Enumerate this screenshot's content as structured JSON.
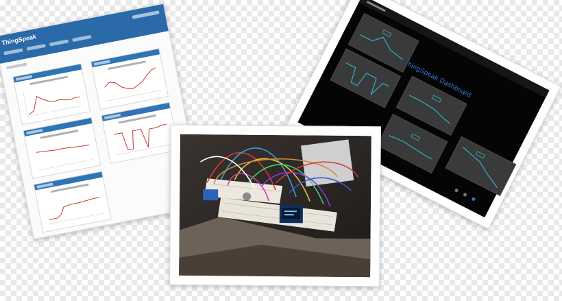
{
  "left_card": {
    "app_name": "ThingSpeak"
  },
  "right_card": {
    "dashboard_title": "ThingSpeak Dashboard"
  },
  "photo_card": {
    "subject": "breadboard-with-oled-display"
  },
  "colors": {
    "thingspeak_blue": "#2a6aa8",
    "chart_red": "#c0392b",
    "dark_accent": "#3b6fd6",
    "dark_line": "#2bb3c4"
  }
}
